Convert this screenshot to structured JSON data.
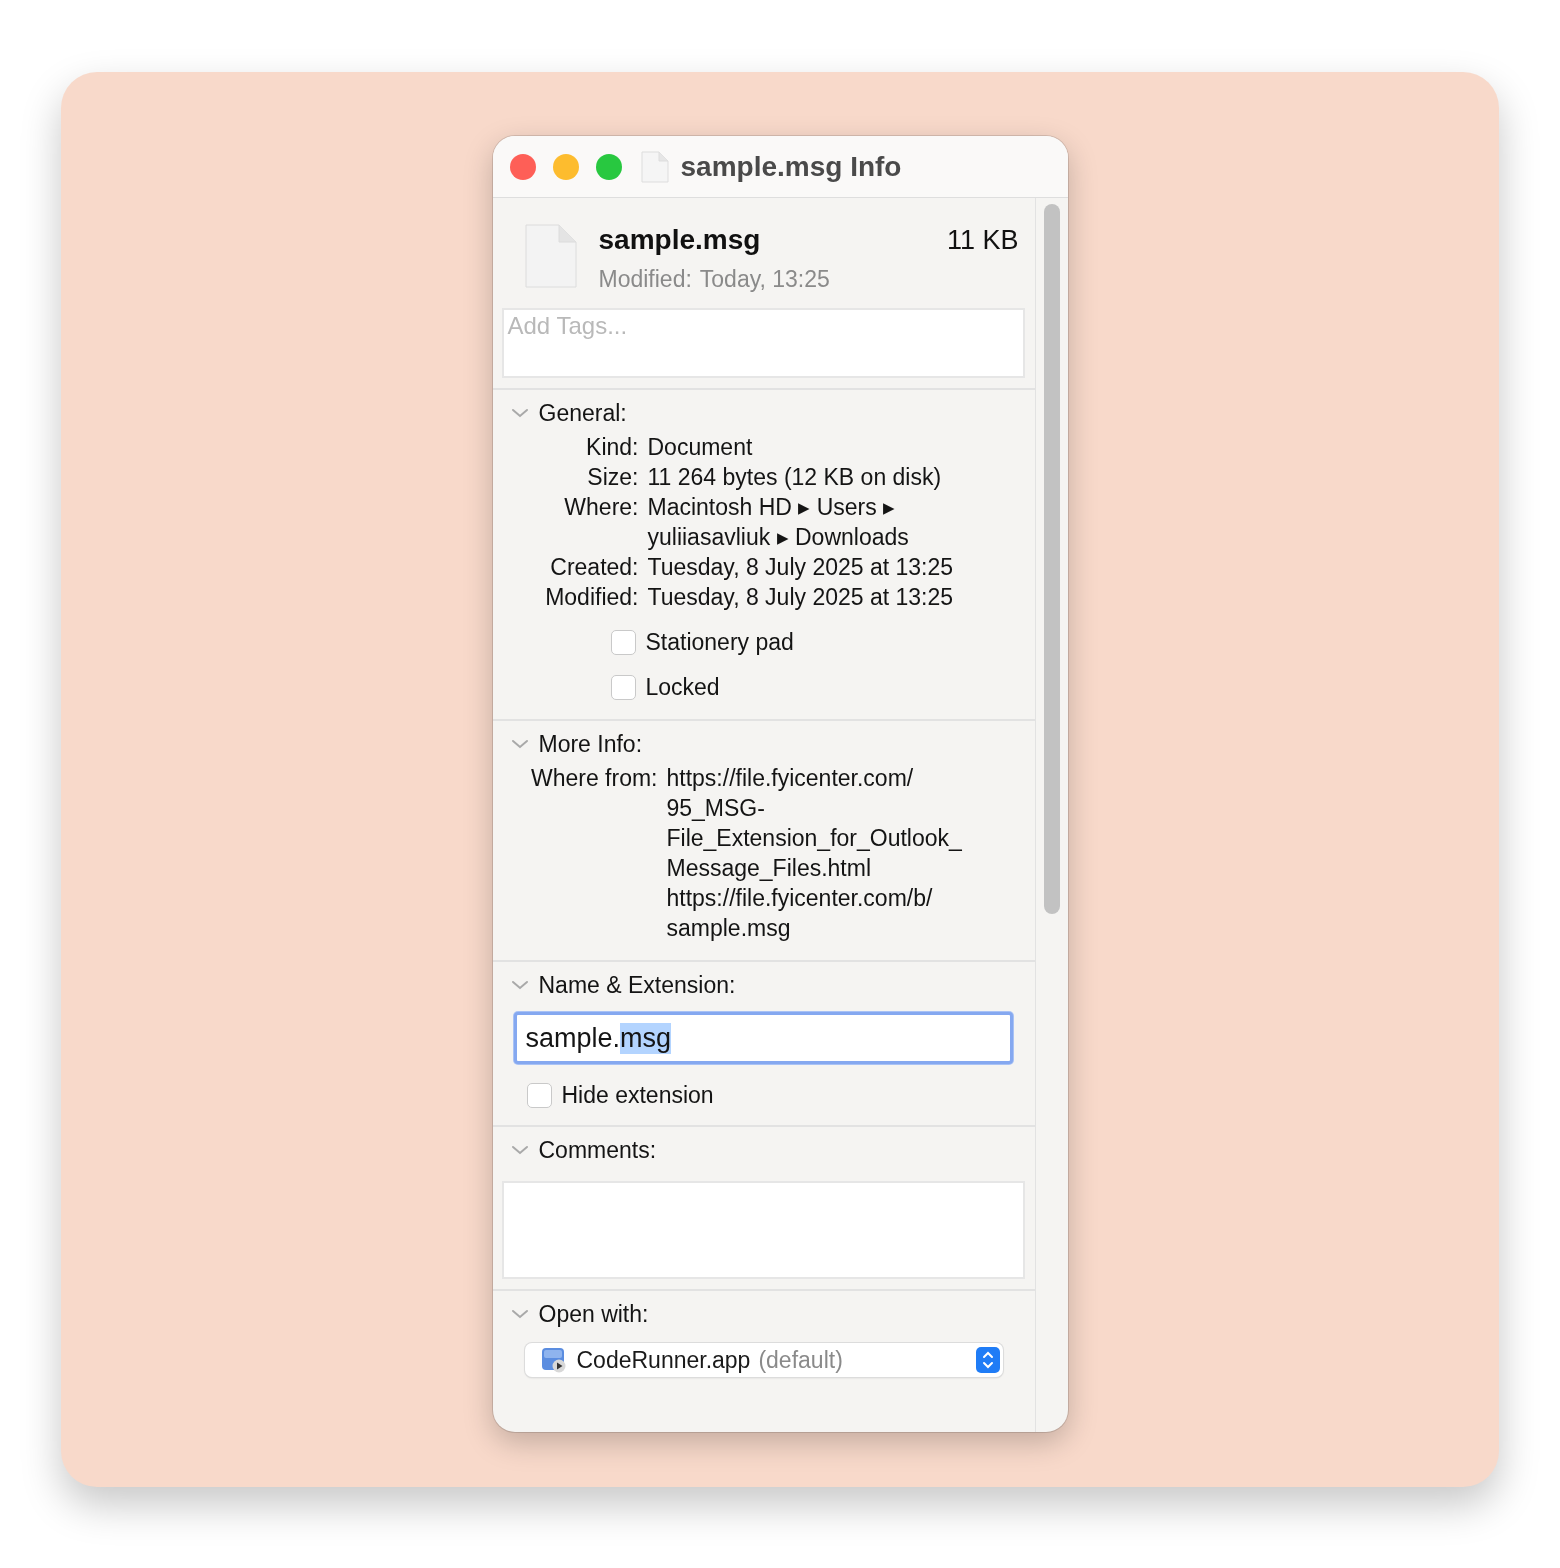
{
  "window": {
    "title": "sample.msg Info"
  },
  "header": {
    "name": "sample.msg",
    "size": "11 KB",
    "modified_label": "Modified:",
    "modified_value": "Today, 13:25"
  },
  "tags_field": {
    "placeholder": "Add Tags..."
  },
  "general": {
    "title": "General:",
    "expanded": true,
    "rows": [
      {
        "label": "Kind:",
        "lines": [
          "Document"
        ]
      },
      {
        "label": "Size:",
        "lines": [
          "11 264 bytes (12 KB on disk)"
        ]
      },
      {
        "label": "Where:",
        "lines": [
          "Macintosh HD ▸ Users ▸",
          "yuliiasavliuk ▸ Downloads"
        ]
      },
      {
        "label": "Created:",
        "lines": [
          "Tuesday, 8 July 2025 at 13:25"
        ]
      },
      {
        "label": "Modified:",
        "lines": [
          "Tuesday, 8 July 2025 at 13:25"
        ]
      }
    ],
    "checkboxes": [
      {
        "label": "Stationery pad",
        "checked": false
      },
      {
        "label": "Locked",
        "checked": false
      }
    ]
  },
  "more_info": {
    "title": "More Info:",
    "expanded": true,
    "rows": [
      {
        "label": "Where from:",
        "lines": [
          "https://file.fyicenter.com/",
          "95_MSG-",
          "File_Extension_for_Outlook_",
          "Message_Files.html",
          "https://file.fyicenter.com/b/",
          "sample.msg"
        ]
      }
    ]
  },
  "name_extension": {
    "title": "Name & Extension:",
    "expanded": true,
    "value_parts": [
      {
        "text": "sample.",
        "selected": false
      },
      {
        "text": "msg",
        "selected": true
      }
    ],
    "hide_extension": {
      "label": "Hide extension",
      "checked": false
    }
  },
  "comments": {
    "title": "Comments:",
    "expanded": true
  },
  "open_with": {
    "title": "Open with:",
    "expanded": true,
    "app": "CodeRunner.app",
    "note": "(default)"
  }
}
